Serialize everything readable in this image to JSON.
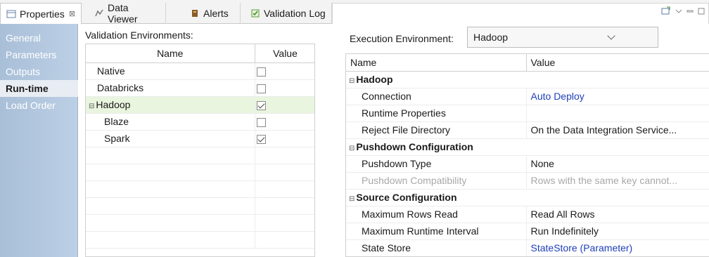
{
  "tabs": [
    {
      "label": "Properties",
      "icon": "properties-icon",
      "close": "⊠",
      "active": true
    },
    {
      "label": "Data Viewer",
      "icon": "data-viewer-icon"
    },
    {
      "label": "Alerts",
      "icon": "alerts-icon"
    },
    {
      "label": "Validation Log",
      "icon": "validation-log-icon"
    }
  ],
  "sidebar": {
    "items": [
      {
        "label": "General"
      },
      {
        "label": "Parameters"
      },
      {
        "label": "Outputs"
      },
      {
        "label": "Run-time",
        "active": true
      },
      {
        "label": "Load Order"
      }
    ]
  },
  "validation": {
    "label": "Validation Environments:",
    "columns": {
      "name": "Name",
      "value": "Value"
    },
    "rows": [
      {
        "name": "Native",
        "checked": false
      },
      {
        "name": "Databricks",
        "checked": false
      },
      {
        "name": "Hadoop",
        "checked": true,
        "expander": "⊟"
      },
      {
        "name": "Blaze",
        "checked": false
      },
      {
        "name": "Spark",
        "checked": true
      }
    ]
  },
  "execution": {
    "label": "Execution Environment:",
    "selected": "Hadoop"
  },
  "properties": {
    "columns": {
      "name": "Name",
      "value": "Value"
    },
    "groups": {
      "hadoop": {
        "title": "Hadoop",
        "connection": {
          "name": "Connection",
          "value": "Auto Deploy"
        },
        "runtime_properties": {
          "name": "Runtime Properties",
          "value": ""
        },
        "reject_dir": {
          "name": "Reject File Directory",
          "value": "On the Data Integration Service..."
        }
      },
      "pushdown": {
        "title": "Pushdown Configuration",
        "type": {
          "name": "Pushdown Type",
          "value": "None"
        },
        "compat": {
          "name": "Pushdown Compatibility",
          "value": "Rows with the same key cannot..."
        }
      },
      "source": {
        "title": "Source Configuration",
        "max_rows": {
          "name": "Maximum Rows Read",
          "value": "Read All Rows"
        },
        "max_interval": {
          "name": "Maximum Runtime Interval",
          "value": "Run Indefinitely"
        },
        "state_store": {
          "name": "State Store",
          "value": "StateStore (Parameter)"
        }
      }
    }
  },
  "colors": {
    "accent_link": "#1f3fb8",
    "highlight_row": "#e9f5de",
    "sidebar": "#a9bfd8"
  }
}
